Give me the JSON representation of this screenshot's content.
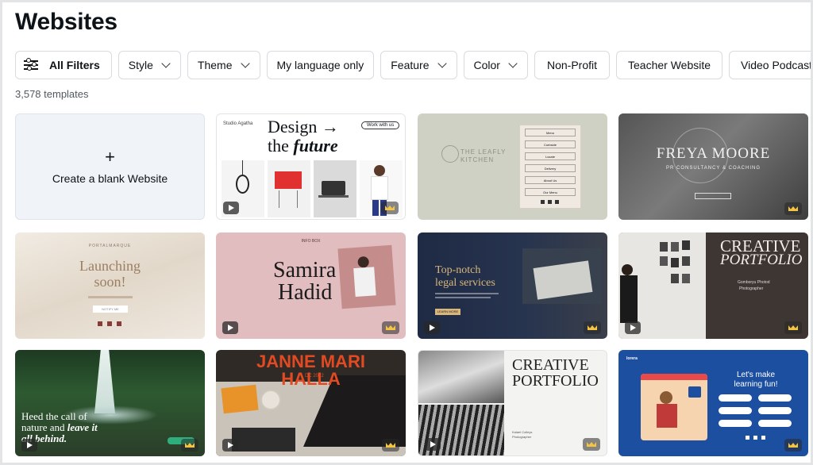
{
  "page": {
    "title": "Websites",
    "template_count": "3,578 templates"
  },
  "filters": {
    "all": "All Filters",
    "style": "Style",
    "theme": "Theme",
    "language": "My language only",
    "feature": "Feature",
    "color": "Color",
    "nonprofit": "Non-Profit",
    "teacher": "Teacher Website",
    "podcast": "Video Podcast Webs"
  },
  "blank_card": {
    "plus": "+",
    "label": "Create a blank Website"
  },
  "templates": {
    "design_future": {
      "line1": "Design →",
      "line2a": "the ",
      "line2b": "future",
      "brand": "Studio Agatha",
      "button": "Work with us"
    },
    "leafly": {
      "name": "THE LEAFLY KITCHEN",
      "menu": [
        "Menu",
        "Curbside",
        "Locate",
        "Delivery",
        "About Us",
        "Our Menu"
      ]
    },
    "freya": {
      "name": "FREYA MOORE",
      "sub": "PR CONSULTANCY & COACHING"
    },
    "launching": {
      "brand": "PORTALMARQUE",
      "line1": "Launching",
      "line2": "soon!",
      "button": "NOTIFY ME"
    },
    "samira": {
      "line1": "Samira",
      "line2": "Hadid",
      "top": "INFO BOX"
    },
    "legal": {
      "line1": "Top-notch",
      "line2": "legal services",
      "button": "LEARN MORE"
    },
    "creative1": {
      "line1": "CREATIVE",
      "line2": "PORTFOLIO",
      "caption": "Gomboryu Photod",
      "caption2": "Photographer"
    },
    "waterfall": {
      "line1": "Heed the call of",
      "line2a": "nature and ",
      "line2b": "leave it",
      "line3": "all behind."
    },
    "janne": {
      "line1": "JANNE MARI",
      "line2": "HALLA",
      "date": "DC 2022"
    },
    "creative2": {
      "line1": "CREATIVE",
      "line2": "PORTFOLIO",
      "caption": "Kaiael Colleys",
      "caption2": "Photographer"
    },
    "learning": {
      "line1": "Let's make",
      "line2": "learning fun!",
      "brand": "lorera"
    }
  }
}
